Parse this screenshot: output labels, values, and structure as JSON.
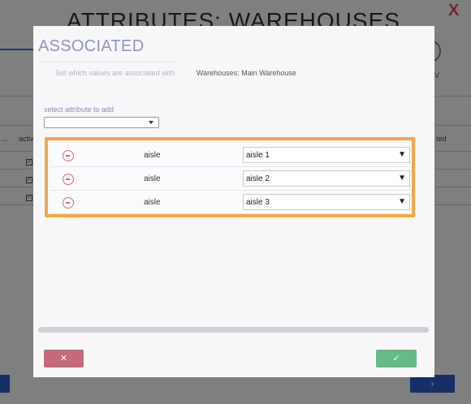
{
  "background": {
    "page_title": "ATTRIBUTES:  WAREHOUSES",
    "close_icon": "X",
    "column_partial_left": "activ",
    "column_partial_right": "ted",
    "ellipsis": "...",
    "check": "✓",
    "v_label": "V",
    "next_button": "›"
  },
  "modal": {
    "title": "ASSOCIATED",
    "hint_label": "Set which values are associated with",
    "hint_value": "Warehouses: Main Warehouse",
    "attribute_label": "select attribute to add",
    "attribute_select_value": "",
    "rows": [
      {
        "name": "aisle",
        "value": "aisle 1"
      },
      {
        "name": "aisle",
        "value": "aisle 2"
      },
      {
        "name": "aisle",
        "value": "aisle 3"
      }
    ],
    "select_arrow": "▼",
    "cancel_icon": "✕",
    "confirm_icon": "✓"
  },
  "colors": {
    "highlight": "#f5a742",
    "title": "#8a97c0",
    "cancel": "#c46a79",
    "confirm": "#66ba87",
    "remove": "#e06a5a"
  }
}
